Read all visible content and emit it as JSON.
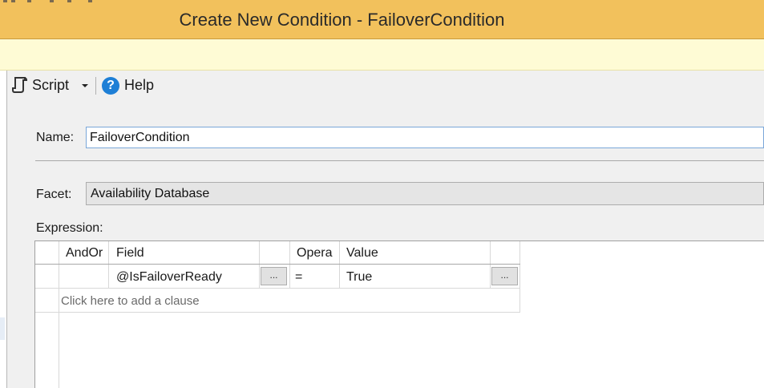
{
  "window": {
    "title": "Create New Condition - FailoverCondition"
  },
  "toolbar": {
    "script_label": "Script",
    "help_label": "Help",
    "help_glyph": "?"
  },
  "form": {
    "name_label": "Name:",
    "name_value": "FailoverCondition",
    "facet_label": "Facet:",
    "facet_value": "Availability Database",
    "expression_label": "Expression:"
  },
  "grid": {
    "columns": [
      "AndOr",
      "Field",
      "",
      "Opera",
      "Value",
      ""
    ],
    "rows": [
      {
        "andor": "",
        "field": "@IsFailoverReady",
        "field_button": "...",
        "operator": "=",
        "value": "True",
        "value_button": "..."
      }
    ],
    "add_clause": "Click here to add a clause"
  },
  "colors": {
    "titlebar": "#f2c15c",
    "infobar": "#fefbd5",
    "pane": "#f0f0f0",
    "accent": "#1e7fd6"
  }
}
